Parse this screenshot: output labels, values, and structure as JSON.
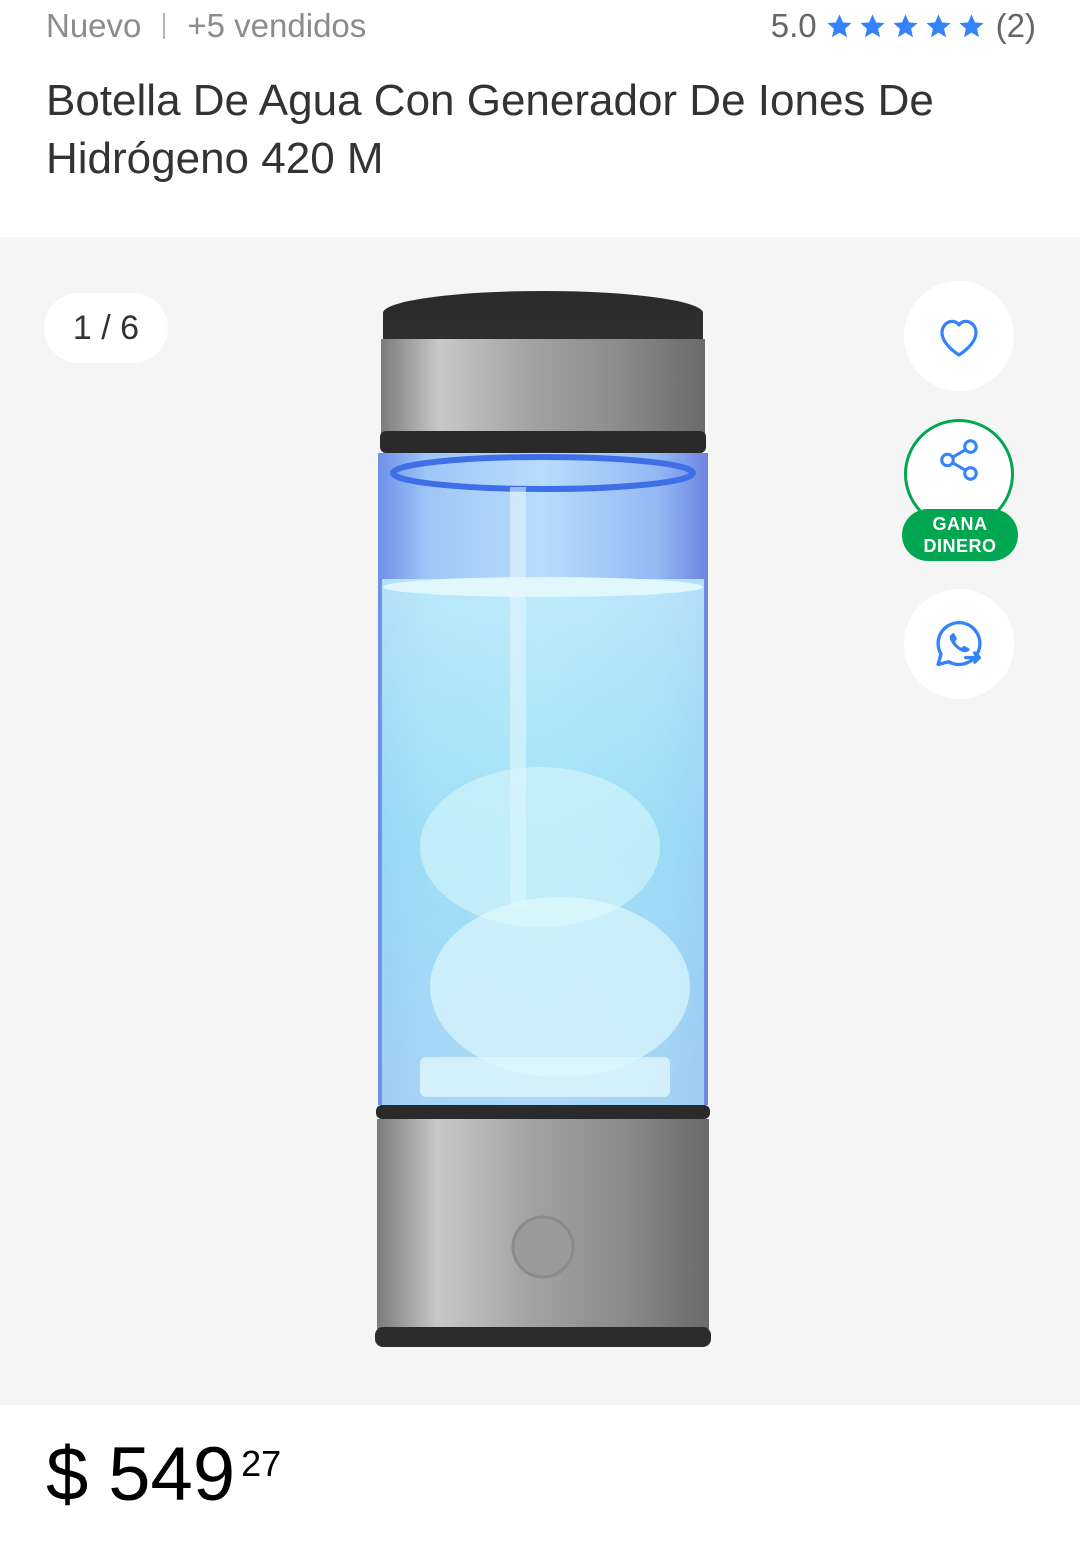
{
  "meta": {
    "condition": "Nuevo",
    "sold": "+5 vendidos",
    "rating": "5.0",
    "reviews": "(2)",
    "star_color": "#3483fa"
  },
  "product": {
    "title": "Botella De Agua Con Generador De Iones De Hidrógeno 420 M",
    "image_icon": "hydrogen-water-bottle"
  },
  "gallery": {
    "counter": "1 / 6",
    "earn_badge_line1": "GANA",
    "earn_badge_line2": "DINERO",
    "accent_blue": "#3483fa",
    "accent_green": "#00a650"
  },
  "price": {
    "currency": "$",
    "amount": "549",
    "cents": "27"
  }
}
